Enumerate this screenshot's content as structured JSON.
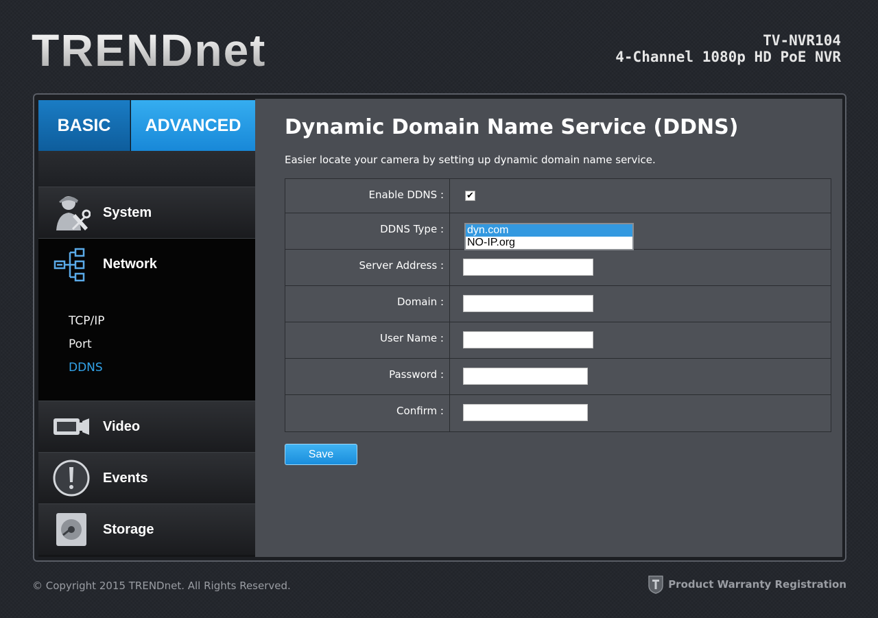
{
  "header": {
    "logo": "TRENDnet",
    "model": "TV-NVR104",
    "product": "4-Channel 1080p HD PoE NVR"
  },
  "tabs": {
    "basic": "BASIC",
    "advanced": "ADVANCED"
  },
  "nav": {
    "system": "System",
    "network": "Network",
    "network_sub": [
      "TCP/IP",
      "Port",
      "DDNS"
    ],
    "video": "Video",
    "events": "Events",
    "storage": "Storage"
  },
  "main": {
    "title": "Dynamic Domain Name Service (DDNS)",
    "description": "Easier locate your camera by setting up dynamic domain name service.",
    "fields": {
      "enable_ddns": "Enable DDNS :",
      "ddns_type": "DDNS Type :",
      "server_address": "Server Address :",
      "domain": "Domain :",
      "user_name": "User Name :",
      "password": "Password :",
      "confirm": "Confirm :"
    },
    "enable_checked": true,
    "checkmark": "✔",
    "ddns_options": [
      "dyn.com",
      "NO-IP.org"
    ],
    "save_label": "Save"
  },
  "footer": {
    "copyright": "© Copyright 2015 TRENDnet. All Rights Reserved.",
    "warranty": "Product Warranty Registration"
  },
  "colors": {
    "accent": "#33a4ea",
    "button": "#1a8ddc"
  }
}
